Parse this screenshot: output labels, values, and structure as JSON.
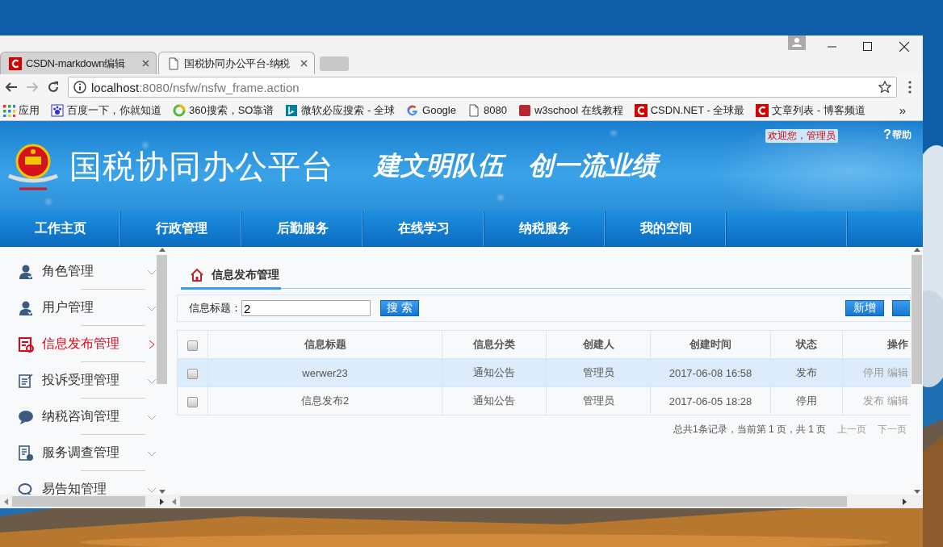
{
  "browser": {
    "tabs": [
      {
        "title": "CSDN-markdown编辑",
        "kind": "csdn",
        "selected": false
      },
      {
        "title": "国税协同办公平台-纳税",
        "kind": "page",
        "selected": true
      }
    ],
    "address": {
      "host": "localhost",
      "path": ":8080/nsfw/nsfw_frame.action"
    },
    "bookmarks": [
      {
        "label": "应用",
        "kind": "apps"
      },
      {
        "label": "百度一下，你就知道",
        "kind": "baidu"
      },
      {
        "label": "360搜索，SO靠谱",
        "kind": "so360"
      },
      {
        "label": "微软必应搜索 - 全球",
        "kind": "bing"
      },
      {
        "label": "Google",
        "kind": "google"
      },
      {
        "label": "8080",
        "kind": "page"
      },
      {
        "label": "w3school 在线教程",
        "kind": "w3"
      },
      {
        "label": "CSDN.NET - 全球最",
        "kind": "csdn"
      },
      {
        "label": "文章列表 - 博客频道",
        "kind": "csdn"
      }
    ],
    "more": "»"
  },
  "banner": {
    "title": "国税协同办公平台",
    "slogan": [
      "建文明队伍",
      "创一流业绩"
    ],
    "welcome": "欢迎您，管理员",
    "help_mark": "?",
    "help": "帮助"
  },
  "nav": [
    "工作主页",
    "行政管理",
    "后勤服务",
    "在线学习",
    "纳税服务",
    "我的空间"
  ],
  "sidebar": [
    {
      "label": "角色管理",
      "kind": "person",
      "selected": false
    },
    {
      "label": "用户管理",
      "kind": "person",
      "selected": false
    },
    {
      "label": "信息发布管理",
      "kind": "notice",
      "selected": true
    },
    {
      "label": "投诉受理管理",
      "kind": "form",
      "selected": false
    },
    {
      "label": "纳税咨询管理",
      "kind": "chat",
      "selected": false
    },
    {
      "label": "服务调查管理",
      "kind": "survey",
      "selected": false
    },
    {
      "label": "易告知管理",
      "kind": "bubble",
      "selected": false
    }
  ],
  "page": {
    "breadcrumb": "信息发布管理",
    "search": {
      "label": "信息标题：",
      "value": "2",
      "button": "搜 索"
    },
    "actions": [
      "新增"
    ],
    "table": {
      "header_checked": false,
      "columns": [
        "信息标题",
        "信息分类",
        "创建人",
        "创建时间",
        "状态",
        "操作"
      ],
      "rows": [
        {
          "selected": true,
          "checked": false,
          "cells": [
            "werwer23",
            "通知公告",
            "管理员",
            "2017-06-08 16:58",
            "发布"
          ],
          "actions": [
            "停用",
            "编辑"
          ]
        },
        {
          "selected": false,
          "checked": false,
          "cells": [
            "信息发布2",
            "通知公告",
            "管理员",
            "2017-06-05 18:28",
            "停用"
          ],
          "actions": [
            "发布",
            "编辑"
          ]
        }
      ]
    },
    "pager": {
      "summary": "总共1条记录，当前第 1 页，共 1 页",
      "links": [
        "上一页",
        "下一页"
      ]
    }
  }
}
